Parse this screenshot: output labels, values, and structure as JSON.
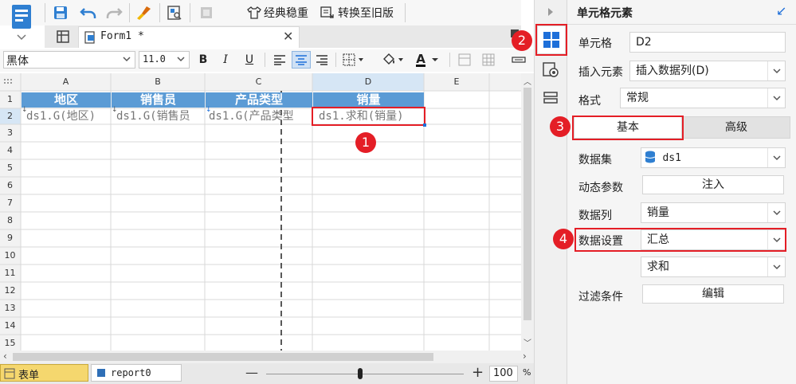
{
  "toolbar": {
    "template_stable_label": "经典稳重",
    "convert_old_label": "转换至旧版"
  },
  "tabs": {
    "form_tab": "Form1 *"
  },
  "format_bar": {
    "font_name": "黑体",
    "font_size": "11.0",
    "bold": "B",
    "italic": "I",
    "underline": "U",
    "font_color": "A"
  },
  "grid": {
    "columns": [
      "A",
      "B",
      "C",
      "D",
      "E"
    ],
    "rows": [
      "1",
      "2",
      "3",
      "4",
      "5",
      "6",
      "7",
      "8",
      "9",
      "10",
      "11",
      "12",
      "13",
      "14",
      "15"
    ],
    "header_cells": [
      "地区",
      "销售员",
      "产品类型",
      "销量"
    ],
    "data_cells": [
      "ds1.G(地区)",
      "ds1.G(销售员",
      "ds1.G(产品类型",
      "ds1.求和(销量)"
    ]
  },
  "bottom": {
    "sheet_tab": "表单",
    "report_tab": "report0",
    "zoom_value": "100",
    "percent": "%"
  },
  "panel": {
    "title": "单元格元素",
    "cell_label": "单元格",
    "cell_value": "D2",
    "insert_label": "插入元素",
    "insert_value": "插入数据列(D)",
    "format_label": "格式",
    "format_value": "常规",
    "tab_basic": "基本",
    "tab_advanced": "高级",
    "dataset_label": "数据集",
    "dataset_value": "ds1",
    "dynamic_param_label": "动态参数",
    "inject_button": "注入",
    "data_column_label": "数据列",
    "data_column_value": "销量",
    "data_setting_label": "数据设置",
    "data_setting_value": "汇总",
    "aggregate_value": "求和",
    "filter_label": "过滤条件",
    "edit_button": "编辑"
  },
  "badges": [
    "1",
    "2",
    "3",
    "4"
  ],
  "colors": {
    "header_blue": "#5b9bd5",
    "accent_blue": "#1e6fd9",
    "highlight_red": "#e41e26"
  }
}
